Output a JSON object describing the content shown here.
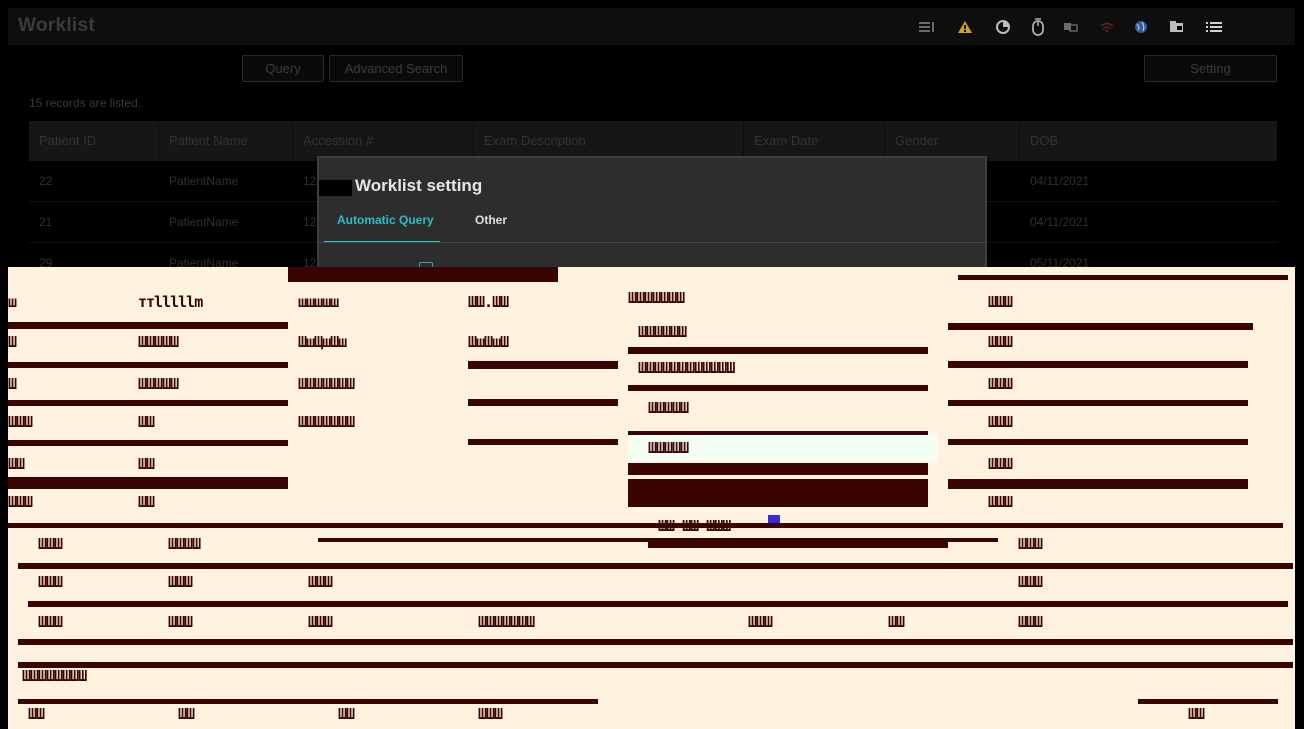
{
  "app": {
    "title": "Worklist"
  },
  "toolbar": {
    "query_label": "Query",
    "advanced_search_label": "Advanced Search",
    "setting_label": "Setting"
  },
  "records_text": "15 records are listed.",
  "table": {
    "headers": [
      "Patient ID",
      "Patient Name",
      "Accession #",
      "Exam Description",
      "Exam Date",
      "Gender",
      "DOB"
    ],
    "rows": [
      {
        "id": "22",
        "name": "PatientName",
        "accession": "12",
        "dob": "04/11/2021"
      },
      {
        "id": "21",
        "name": "PatientName",
        "accession": "12",
        "dob": "04/11/2021"
      },
      {
        "id": "29",
        "name": "PatientName",
        "accession": "12",
        "dob": "05/11/2021"
      }
    ]
  },
  "dialog": {
    "title": "Worklist setting",
    "tabs": [
      "Automatic Query",
      "Other"
    ],
    "active_tab_color": "#25c0c8"
  },
  "status_icons": [
    "list-rows-icon",
    "warning-icon",
    "pie-chart-icon",
    "mouse-icon",
    "display-icon",
    "network-icon",
    "globe-icon",
    "folder-icon",
    "menu-icon"
  ],
  "colors": {
    "background": "#000000",
    "accent": "#25c0c8",
    "warning": "#d4a21a",
    "corruption": "#fff3df"
  }
}
